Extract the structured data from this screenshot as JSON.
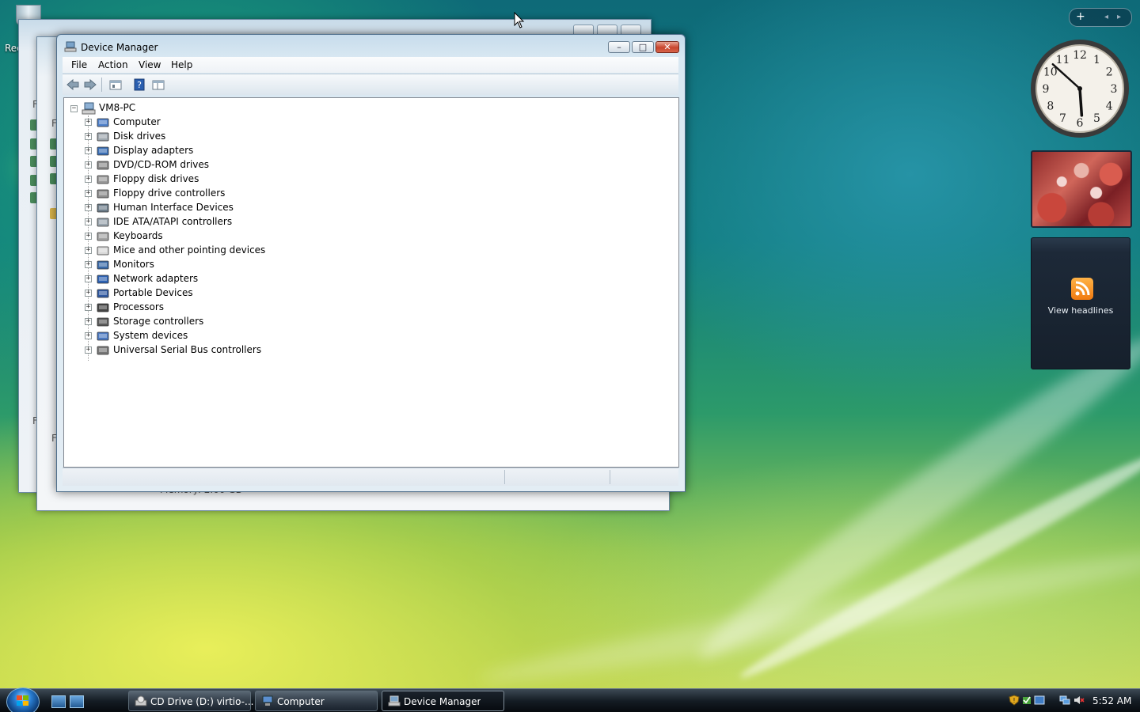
{
  "desktop": {
    "recycle_bin_label": "Rec",
    "background_memory_text": "Memory: 2.00 GB",
    "background_window_letters": [
      "F",
      "F",
      "F",
      "F"
    ]
  },
  "window": {
    "title": "Device Manager",
    "buttons": {
      "minimize": "–",
      "maximize": "□",
      "close": "✕"
    }
  },
  "menu": {
    "items": [
      "File",
      "Action",
      "View",
      "Help"
    ]
  },
  "toolbar": {
    "icons": [
      "back-icon",
      "forward-icon",
      "properties-icon",
      "help-icon",
      "show-hide-console-tree-icon"
    ]
  },
  "tree": {
    "root": "VM8-PC",
    "nodes": [
      {
        "label": "Computer",
        "icon": "computer-icon"
      },
      {
        "label": "Disk drives",
        "icon": "disk-drive-icon"
      },
      {
        "label": "Display adapters",
        "icon": "display-adapter-icon"
      },
      {
        "label": "DVD/CD-ROM drives",
        "icon": "dvd-drive-icon"
      },
      {
        "label": "Floppy disk drives",
        "icon": "floppy-disk-icon"
      },
      {
        "label": "Floppy drive controllers",
        "icon": "floppy-controller-icon"
      },
      {
        "label": "Human Interface Devices",
        "icon": "hid-icon"
      },
      {
        "label": "IDE ATA/ATAPI controllers",
        "icon": "ide-controller-icon"
      },
      {
        "label": "Keyboards",
        "icon": "keyboard-icon"
      },
      {
        "label": "Mice and other pointing devices",
        "icon": "mouse-icon"
      },
      {
        "label": "Monitors",
        "icon": "monitor-icon"
      },
      {
        "label": "Network adapters",
        "icon": "network-adapter-icon"
      },
      {
        "label": "Portable Devices",
        "icon": "portable-device-icon"
      },
      {
        "label": "Processors",
        "icon": "processor-icon"
      },
      {
        "label": "Storage controllers",
        "icon": "storage-controller-icon"
      },
      {
        "label": "System devices",
        "icon": "system-device-icon"
      },
      {
        "label": "Universal Serial Bus controllers",
        "icon": "usb-icon"
      }
    ]
  },
  "gadgets": {
    "feed_label": "View headlines",
    "clock_numbers": [
      "12",
      "1",
      "2",
      "3",
      "4",
      "5",
      "6",
      "7",
      "8",
      "9",
      "10",
      "11"
    ],
    "clock_time": {
      "hour": 5,
      "minute": 52
    }
  },
  "taskbar": {
    "tasks": [
      {
        "label": "CD Drive (D:) virtio-...",
        "active": false
      },
      {
        "label": "Computer",
        "active": false
      },
      {
        "label": "Device Manager",
        "active": true
      }
    ],
    "clock": "5:52 AM"
  },
  "colors": {
    "close_button": "#c8452d",
    "window_frame": "#c7dcec",
    "taskbar": "#141c24"
  }
}
